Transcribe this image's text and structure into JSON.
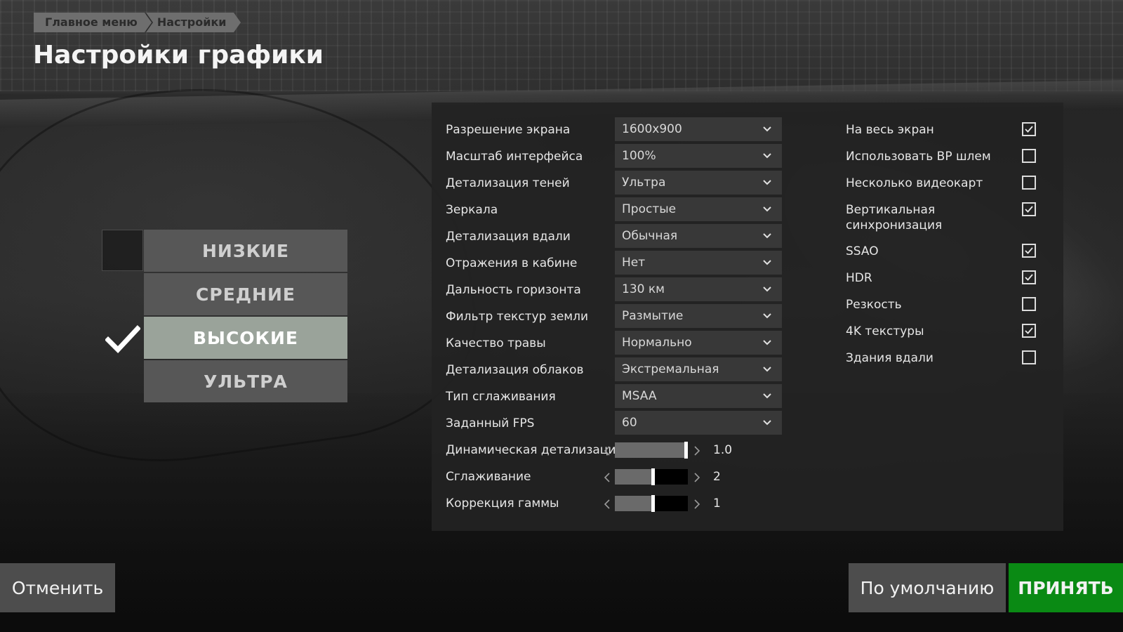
{
  "breadcrumb": [
    "Главное меню",
    "Настройки"
  ],
  "title": "Настройки графики",
  "presets": [
    {
      "label": "НИЗКИЕ",
      "active": false
    },
    {
      "label": "СРЕДНИЕ",
      "active": false
    },
    {
      "label": "ВЫСОКИЕ",
      "active": true
    },
    {
      "label": "УЛЬТРА",
      "active": false
    }
  ],
  "dropdowns": [
    {
      "label": "Разрешение экрана",
      "value": "1600x900"
    },
    {
      "label": "Масштаб интерфейса",
      "value": "100%"
    },
    {
      "label": "Детализация теней",
      "value": "Ультра"
    },
    {
      "label": "Зеркала",
      "value": "Простые"
    },
    {
      "label": "Детализация вдали",
      "value": "Обычная"
    },
    {
      "label": "Отражения в кабине",
      "value": "Нет"
    },
    {
      "label": "Дальность горизонта",
      "value": "130 км"
    },
    {
      "label": "Фильтр текстур земли",
      "value": "Размытие"
    },
    {
      "label": "Качество травы",
      "value": "Нормально"
    },
    {
      "label": "Детализация облаков",
      "value": "Экстремальная"
    },
    {
      "label": "Тип сглаживания",
      "value": "MSAA"
    },
    {
      "label": "Заданный FPS",
      "value": "60"
    }
  ],
  "sliders": [
    {
      "label": "Динамическая детализация",
      "value": "1.0",
      "level": 0.97
    },
    {
      "label": "Сглаживание",
      "value": "2",
      "level": 0.5
    },
    {
      "label": "Коррекция гаммы",
      "value": "1",
      "level": 0.5
    }
  ],
  "checkboxes": [
    {
      "label": "На весь экран",
      "checked": true
    },
    {
      "label": "Использовать ВР шлем",
      "checked": false
    },
    {
      "label": "Несколько видеокарт",
      "checked": false
    },
    {
      "label": "Вертикальная синхронизация",
      "checked": true
    },
    {
      "label": "SSAO",
      "checked": true
    },
    {
      "label": "HDR",
      "checked": true
    },
    {
      "label": "Резкость",
      "checked": false
    },
    {
      "label": "4K текстуры",
      "checked": true
    },
    {
      "label": "Здания вдали",
      "checked": false
    }
  ],
  "buttons": {
    "cancel": "Отменить",
    "default": "По умолчанию",
    "accept": "ПРИНЯТЬ"
  },
  "colors": {
    "accent_green": "#0a8a14",
    "preset_active": "#9aa39a",
    "preset_inactive": "#575757"
  }
}
